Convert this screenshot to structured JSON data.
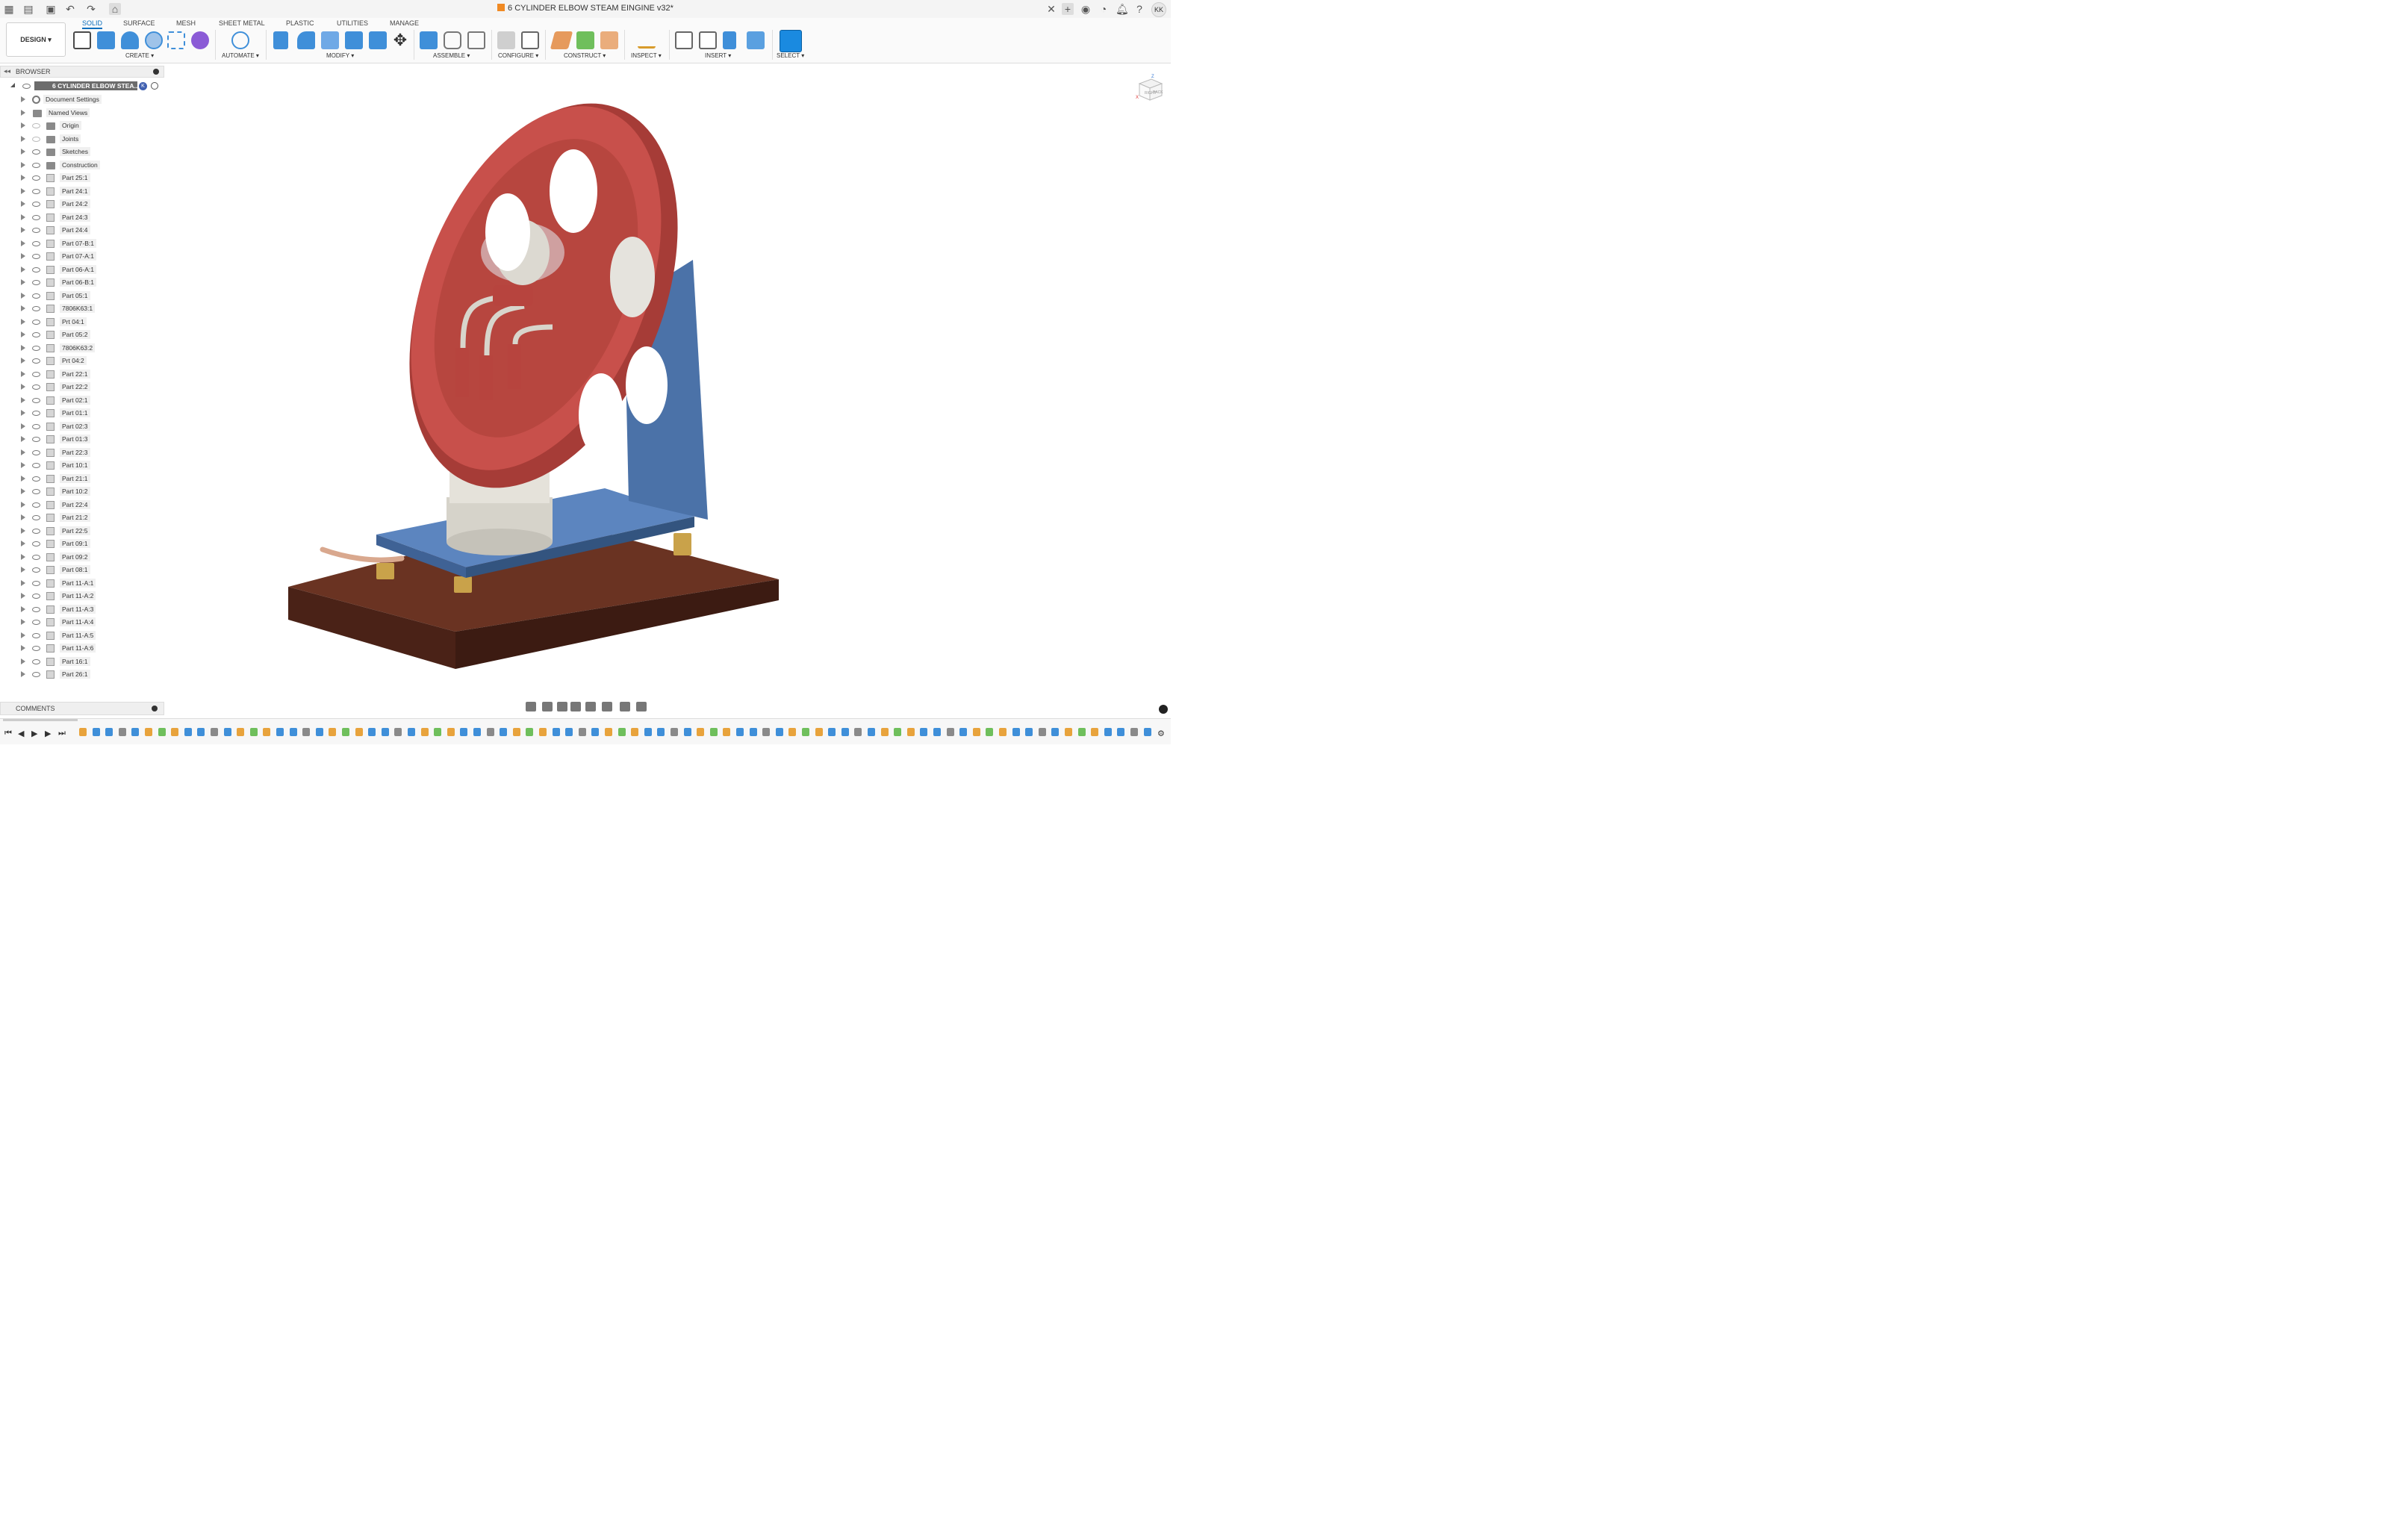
{
  "window": {
    "title": "6 CYLINDER ELBOW STEAM EINGINE v32*",
    "user_initials": "KK"
  },
  "ribbon": {
    "workspace_button": "DESIGN ▾",
    "tabs": [
      "SOLID",
      "SURFACE",
      "MESH",
      "SHEET METAL",
      "PLASTIC",
      "UTILITIES",
      "MANAGE"
    ],
    "active_tab": "SOLID",
    "groups": [
      "CREATE ▾",
      "AUTOMATE ▾",
      "MODIFY ▾",
      "ASSEMBLE ▾",
      "CONFIGURE ▾",
      "CONSTRUCT ▾",
      "INSPECT ▾",
      "INSERT ▾",
      "SELECT ▾"
    ]
  },
  "browser": {
    "title": "BROWSER",
    "root": "6 CYLINDER ELBOW STEA...",
    "items": [
      "Document Settings",
      "Named Views",
      "Origin",
      "Joints",
      "Sketches",
      "Construction",
      "Part 25:1",
      "Part 24:1",
      "Part 24:2",
      "Part 24:3",
      "Part 24:4",
      "Part 07-B:1",
      "Part 07-A:1",
      "Part 06-A:1",
      "Part 06-B:1",
      "Part 05:1",
      "7806K63:1",
      "Prt 04:1",
      "Part 05:2",
      "7806K63:2",
      "Prt 04:2",
      "Part 22:1",
      "Part 22:2",
      "Part 02:1",
      "Part 01:1",
      "Part 02:3",
      "Part 01:3",
      "Part 22:3",
      "Part 10:1",
      "Part 21:1",
      "Part 10:2",
      "Part 22:4",
      "Part 21:2",
      "Part 22:5",
      "Part 09:1",
      "Part 09:2",
      "Part 08:1",
      "Part 11-A:1",
      "Part 11-A:2",
      "Part 11-A:3",
      "Part 11-A:4",
      "Part 11-A:5",
      "Part 11-A:6",
      "Part 16:1",
      "Part 26:1"
    ]
  },
  "comments": {
    "title": "COMMENTS"
  },
  "viewcube": {
    "face_front": "RIGHT",
    "face_side": "BACK",
    "axis_z": "Z",
    "axis_x": "X"
  },
  "colors": {
    "flywheel": "#c8504b",
    "frame": "#4b72a8",
    "base": "#5a2a1c",
    "cylinder": "#dedbd3",
    "accent": "#0b6ebd"
  }
}
